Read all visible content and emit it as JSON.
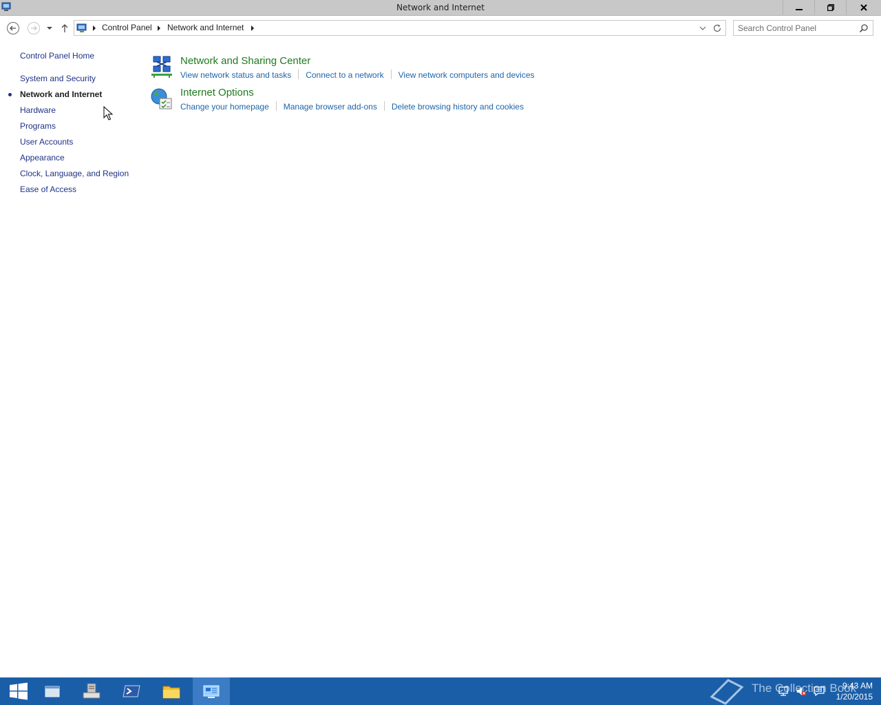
{
  "window": {
    "title": "Network and Internet"
  },
  "address_bar": {
    "crumbs": [
      "Control Panel",
      "Network and Internet"
    ]
  },
  "search": {
    "placeholder": "Search Control Panel"
  },
  "left_nav": {
    "home": "Control Panel Home",
    "items": [
      {
        "label": "System and Security",
        "current": false
      },
      {
        "label": "Network and Internet",
        "current": true
      },
      {
        "label": "Hardware",
        "current": false
      },
      {
        "label": "Programs",
        "current": false
      },
      {
        "label": "User Accounts",
        "current": false
      },
      {
        "label": "Appearance",
        "current": false
      },
      {
        "label": "Clock, Language, and Region",
        "current": false
      },
      {
        "label": "Ease of Access",
        "current": false
      }
    ]
  },
  "categories": [
    {
      "title": "Network and Sharing Center",
      "icon": "network-sharing-icon",
      "links": [
        "View network status and tasks",
        "Connect to a network",
        "View network computers and devices"
      ]
    },
    {
      "title": "Internet Options",
      "icon": "internet-options-icon",
      "links": [
        "Change your homepage",
        "Manage browser add-ons",
        "Delete browsing history and cookies"
      ]
    }
  ],
  "taskbar": {
    "watermark": "The Collection Book",
    "clock_time": "9:43 AM",
    "clock_date": "1/20/2015"
  },
  "colors": {
    "taskbar": "#1a5ea8",
    "link": "#1e64a8",
    "category_title": "#1e7a1e",
    "nav_link": "#1e3287"
  }
}
